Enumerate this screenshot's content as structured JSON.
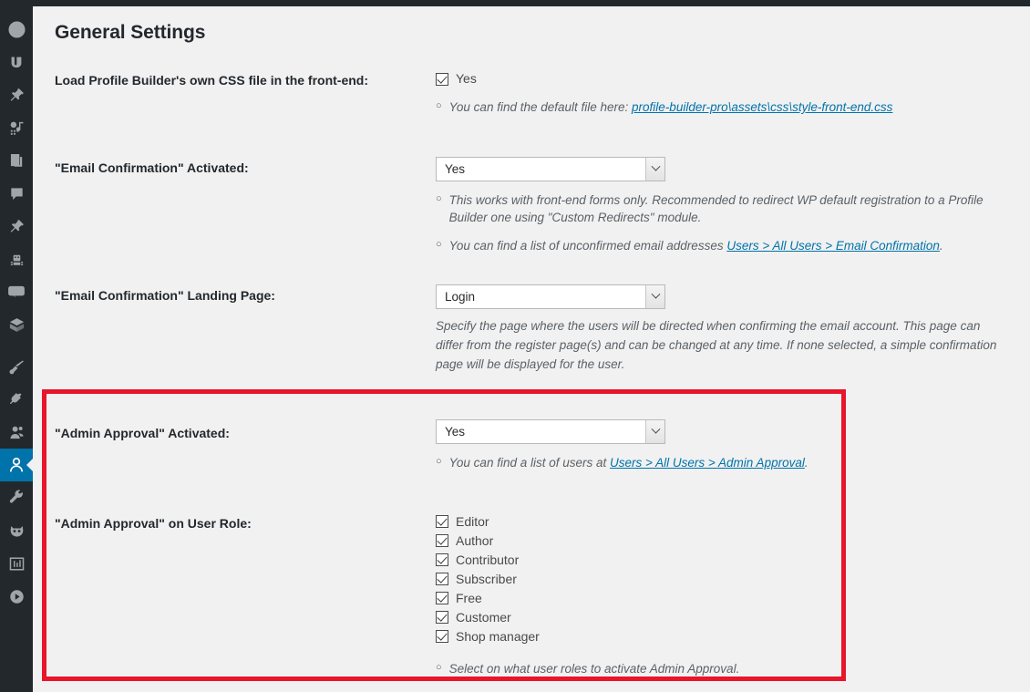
{
  "sidebar": {
    "items": [
      {
        "icon": "dashboard-icon",
        "name": "sidebar-item-dashboard",
        "active": false
      },
      {
        "icon": "scriptless-s-icon",
        "name": "sidebar-item-s-logo",
        "active": false
      },
      {
        "icon": "pin-icon",
        "name": "sidebar-item-posts",
        "active": false
      },
      {
        "icon": "media-icon",
        "name": "sidebar-item-media",
        "active": false
      },
      {
        "icon": "pages-icon",
        "name": "sidebar-item-pages",
        "active": false
      },
      {
        "icon": "comment-icon",
        "name": "sidebar-item-comments",
        "active": false
      },
      {
        "icon": "pin-icon",
        "name": "sidebar-item-portfolio",
        "active": false
      },
      {
        "icon": "robot-icon",
        "name": "sidebar-item-bot",
        "active": false
      },
      {
        "icon": "woo-icon",
        "name": "sidebar-item-woocommerce",
        "active": false
      },
      {
        "icon": "box-icon",
        "name": "sidebar-item-products",
        "active": false
      },
      {
        "icon": "brush-icon",
        "name": "sidebar-item-appearance",
        "active": false
      },
      {
        "icon": "plug-icon",
        "name": "sidebar-item-plugins",
        "active": false
      },
      {
        "icon": "users-icon",
        "name": "sidebar-item-users",
        "active": false
      },
      {
        "icon": "person-icon",
        "name": "sidebar-item-profile-builder",
        "active": true
      },
      {
        "icon": "wrench-icon",
        "name": "sidebar-item-tools",
        "active": false
      },
      {
        "icon": "cat-icon",
        "name": "sidebar-item-wp-rocket",
        "active": false
      },
      {
        "icon": "sliders-icon",
        "name": "sidebar-item-settings",
        "active": false
      },
      {
        "icon": "play-icon",
        "name": "sidebar-item-media-player",
        "active": false
      }
    ]
  },
  "colors": {
    "accent": "#0073aa",
    "sidebar_bg": "#23282d",
    "page_bg": "#f1f1f1",
    "highlight_box": "#e8152b",
    "link": "#0073aa"
  },
  "page": {
    "title": "General Settings"
  },
  "settings": {
    "css_file": {
      "label": "Load Profile Builder's own CSS file in the front-end:",
      "checkbox_label": "Yes",
      "checked": true,
      "hint_prefix": "You can find the default file here: ",
      "hint_link": "profile-builder-pro\\assets\\css\\style-front-end.css"
    },
    "email_confirmation": {
      "label": "\"Email Confirmation\" Activated:",
      "select_value": "Yes",
      "hint1": "This works with front-end forms only. Recommended to redirect WP default registration to a Profile Builder one using \"Custom Redirects\" module.",
      "hint2_prefix": "You can find a list of unconfirmed email addresses ",
      "hint2_link": "Users > All Users > Email Confirmation",
      "hint2_suffix": "."
    },
    "landing_page": {
      "label": "\"Email Confirmation\" Landing Page:",
      "select_value": "Login",
      "hint": "Specify the page where the users will be directed when confirming the email account. This page can differ from the register page(s) and can be changed at any time. If none selected, a simple confirmation page will be displayed for the user."
    },
    "admin_approval": {
      "label": "\"Admin Approval\" Activated:",
      "select_value": "Yes",
      "hint_prefix": "You can find a list of users at ",
      "hint_link": "Users > All Users > Admin Approval",
      "hint_suffix": "."
    },
    "admin_approval_roles": {
      "label": "\"Admin Approval\" on User Role:",
      "roles": [
        {
          "label": "Editor",
          "checked": true
        },
        {
          "label": "Author",
          "checked": true
        },
        {
          "label": "Contributor",
          "checked": true
        },
        {
          "label": "Subscriber",
          "checked": true
        },
        {
          "label": "Free",
          "checked": true
        },
        {
          "label": "Customer",
          "checked": true
        },
        {
          "label": "Shop manager",
          "checked": true
        }
      ],
      "hint": "Select on what user roles to activate Admin Approval."
    }
  }
}
